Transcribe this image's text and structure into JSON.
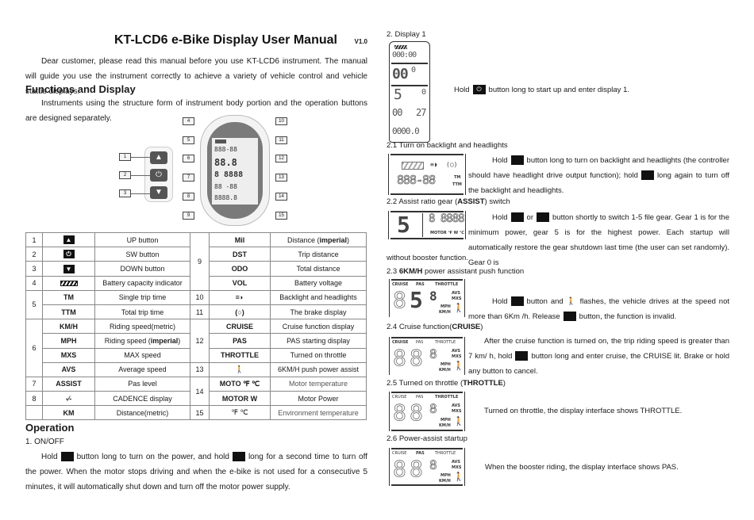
{
  "document": {
    "title": "KT-LCD6 e-Bike Display User Manual",
    "version": "V1.0",
    "intro": "Dear customer, please read this manual before you use KT-LCD6 instrument. The manual will guide you use the instrument correctly to achieve a variety of vehicle control and vehicle status displays.",
    "functions_heading": "Functions and Display",
    "functions_text": "Instruments using the structure form of instrument body portion and the operation buttons are designed separately."
  },
  "diagram": {
    "callouts": [
      "1",
      "2",
      "3",
      "4",
      "5",
      "6",
      "7",
      "8",
      "9",
      "10",
      "11",
      "12",
      "13",
      "14",
      "15"
    ],
    "lcd_rows": [
      "888-88",
      "88.8",
      "8 8888",
      "88 -88",
      "8888.8"
    ]
  },
  "table": {
    "rows": [
      {
        "num": "1",
        "icon": "up-button-icon",
        "desc": "UP button"
      },
      {
        "num": "2",
        "icon": "power-button-icon",
        "desc": "SW button"
      },
      {
        "num": "3",
        "icon": "down-button-icon",
        "desc": "DOWN button"
      },
      {
        "num": "4",
        "icon": "battery-icon",
        "desc": "Battery capacity indicator"
      },
      {
        "num": "5",
        "label": "TM",
        "desc": "Single trip time"
      },
      {
        "num": "",
        "label": "TTM",
        "desc": "Total trip time"
      },
      {
        "num": "6",
        "label": "KM/H",
        "desc": "Riding speed(metric)"
      },
      {
        "num": "",
        "label": "MPH",
        "desc": "Riding speed (imperial)"
      },
      {
        "num": "",
        "label": "MXS",
        "desc": "MAX speed"
      },
      {
        "num": "",
        "label": "AVS",
        "desc": "Average speed"
      },
      {
        "num": "7",
        "label": "ASSIST",
        "desc": "Pas level"
      },
      {
        "num": "8",
        "icon": "cadence-icon",
        "desc": "CADENCE display"
      },
      {
        "num": "",
        "label": "KM",
        "desc": "Distance(metric)"
      }
    ],
    "rows_right": [
      {
        "num": "9",
        "label": "Mil",
        "desc_pre": "Distance (",
        "desc_bold": "imperial",
        "desc_post": ")"
      },
      {
        "num": "",
        "label": "DST",
        "desc": "Trip distance"
      },
      {
        "num": "",
        "label": "ODO",
        "desc": "Total distance"
      },
      {
        "num": "",
        "label": "VOL",
        "desc": "Battery voltage"
      },
      {
        "num": "10",
        "icon": "headlight-icon",
        "desc": "Backlight and headlights"
      },
      {
        "num": "11",
        "icon": "brake-icon",
        "desc": "The brake display"
      },
      {
        "num": "12",
        "label": "CRUISE",
        "desc": "Cruise function display"
      },
      {
        "num": "",
        "label": "PAS",
        "desc": "PAS starting display"
      },
      {
        "num": "",
        "label": "THROTTLE",
        "desc": "Turned on throttle"
      },
      {
        "num": "13",
        "icon": "walk-assist-icon",
        "desc": "6KM/H push power assist"
      },
      {
        "num": "14",
        "label": "MOTO  ℉  ℃",
        "desc": "Motor temperature"
      },
      {
        "num": "",
        "label": "MOTOR W",
        "desc": "Motor Power"
      },
      {
        "num": "15",
        "label": "℉  ℃",
        "desc": "Environment temperature"
      }
    ],
    "row6_desc_mph_pre": "Riding speed (",
    "row6_desc_mph_bold": "imperial",
    "row6_desc_mph_post": ")"
  },
  "operation": {
    "heading": "Operation",
    "item1_title": "1.   ON/OFF",
    "item1_hold": "Hold",
    "item1_mid": "button long to turn on the power, and hold",
    "item1_end": "long for a second time to turn off the",
    "item1_rest": "power. When the motor stops driving and when the e-bike is not used for a consecutive 5 minutes, it will automatically shut down and turn off the motor power supply."
  },
  "right": {
    "s2_title": "2.   Display 1",
    "s2_text_hold": "Hold",
    "s2_text_rest": "button long to start up and enter display 1.",
    "s2_lcd": {
      "time": "000:00",
      "speed": "00",
      "speed_dec": "0",
      "assist": "5",
      "power": "0",
      "cadence": "00",
      "temp": "27",
      "odo": "0000.0"
    },
    "s21_title": "2.1    Turn on backlight and headlights",
    "s21_hold": "Hold",
    "s21_a": "button long to turn on backlight and headlights (the controller should have headlight drive output function); hold",
    "s21_b": "long again to turn off the backlight and headlights.",
    "s22_title_pre": "2.2    Assist ratio gear (",
    "s22_title_bold": "ASSIST",
    "s22_title_post": ") switch",
    "s22_hold": "Hold",
    "s22_or": "or",
    "s22_a": "button shortly to switch 1-5 file gear. Gear 1 is for the minimum power, gear 5 is for the highest power. Each startup will automatically restore the gear shutdown last time (the user can set randomly). Gear 0 is",
    "s22_b": "without booster function.",
    "s23_title_pre": "2.3   ",
    "s23_title_bold": "6KM/H",
    "s23_title_post": " power assistant push function",
    "s23_hold": "Hold",
    "s23_a": "button and",
    "s23_b": "flashes, the vehicle drives at the speed not",
    "s23_c": "more than 6Km /h. Release",
    "s23_d": "button, the function is invalid.",
    "s24_title_pre": "2.4   Cruise function(",
    "s24_title_bold": "CRUISE",
    "s24_title_post": ")",
    "s24_a": "After the cruise function is turned on, the trip riding speed is greater than",
    "s24_b": "7 km/ h, hold",
    "s24_c": "button long and enter cruise, the CRUISE lit. Brake or hold",
    "s24_d": "any button to cancel.",
    "s25_title_pre": "2.5    Turned on throttle (",
    "s25_title_bold": "THROTTLE",
    "s25_title_post": ")",
    "s25_text": "Turned on throttle, the display interface shows THROTTLE.",
    "s26_title": "2.6    Power-assist startup",
    "s26_text": "When the booster riding, the display interface shows PAS.",
    "lcd_labels": {
      "cruise": "CRUISE",
      "pas": "PAS",
      "throttle": "THROTTLE",
      "avs": "AVS",
      "mxs": "MXS",
      "mph": "MPH",
      "kmh": "KM/H",
      "tm": "TM",
      "ttm": "TTM",
      "motor": "MOTOR ℉ W ℃",
      "gear": "5",
      "digit8": "8"
    }
  },
  "icons": {
    "up": "▲",
    "down": "▼",
    "power": "⏻",
    "walk": "🚶",
    "cadence": "-⁄-",
    "headlight": "≡◗",
    "brake": "(○)"
  }
}
